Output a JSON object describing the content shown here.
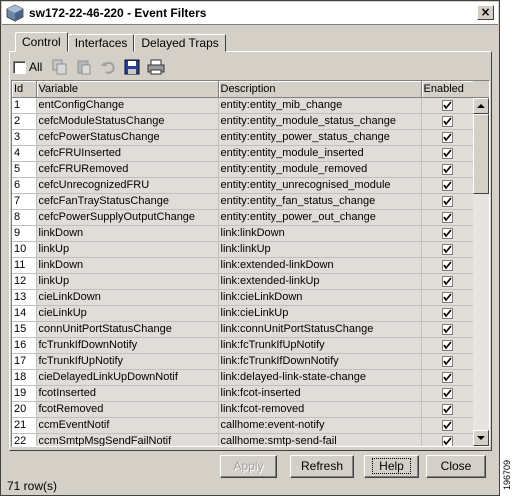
{
  "window": {
    "title": "sw172-22-46-220 - Event Filters",
    "close_label": "×"
  },
  "tabs": [
    {
      "label": "Control",
      "active": true
    },
    {
      "label": "Interfaces",
      "active": false
    },
    {
      "label": "Delayed Traps",
      "active": false
    }
  ],
  "toolbar": {
    "all_label": "All",
    "icons": [
      "copy-icon",
      "paste-icon",
      "undo-icon",
      "save-icon",
      "print-icon"
    ]
  },
  "table": {
    "columns": [
      "Id",
      "Variable",
      "Description",
      "Enabled"
    ],
    "rows": [
      {
        "id": "1",
        "variable": "entConfigChange",
        "description": "entity:entity_mib_change",
        "enabled": true
      },
      {
        "id": "2",
        "variable": "cefcModuleStatusChange",
        "description": "entity:entity_module_status_change",
        "enabled": true
      },
      {
        "id": "3",
        "variable": "cefcPowerStatusChange",
        "description": "entity:entity_power_status_change",
        "enabled": true
      },
      {
        "id": "4",
        "variable": "cefcFRUInserted",
        "description": "entity:entity_module_inserted",
        "enabled": true
      },
      {
        "id": "5",
        "variable": "cefcFRURemoved",
        "description": "entity:entity_module_removed",
        "enabled": true
      },
      {
        "id": "6",
        "variable": "cefcUnrecognizedFRU",
        "description": "entity:entity_unrecognised_module",
        "enabled": true
      },
      {
        "id": "7",
        "variable": "cefcFanTrayStatusChange",
        "description": "entity:entity_fan_status_change",
        "enabled": true
      },
      {
        "id": "8",
        "variable": "cefcPowerSupplyOutputChange",
        "description": "entity:entity_power_out_change",
        "enabled": true
      },
      {
        "id": "9",
        "variable": "linkDown",
        "description": "link:linkDown",
        "enabled": true
      },
      {
        "id": "10",
        "variable": "linkUp",
        "description": "link:linkUp",
        "enabled": true
      },
      {
        "id": "11",
        "variable": "linkDown",
        "description": "link:extended-linkDown",
        "enabled": true
      },
      {
        "id": "12",
        "variable": "linkUp",
        "description": "link:extended-linkUp",
        "enabled": true
      },
      {
        "id": "13",
        "variable": "cieLinkDown",
        "description": "link:cieLinkDown",
        "enabled": true
      },
      {
        "id": "14",
        "variable": "cieLinkUp",
        "description": "link:cieLinkUp",
        "enabled": true
      },
      {
        "id": "15",
        "variable": "connUnitPortStatusChange",
        "description": "link:connUnitPortStatusChange",
        "enabled": true
      },
      {
        "id": "16",
        "variable": "fcTrunkIfDownNotify",
        "description": "link:fcTrunkIfUpNotify",
        "enabled": true
      },
      {
        "id": "17",
        "variable": "fcTrunkIfUpNotify",
        "description": "link:fcTrunkIfDownNotify",
        "enabled": true
      },
      {
        "id": "18",
        "variable": "cieDelayedLinkUpDownNotif",
        "description": "link:delayed-link-state-change",
        "enabled": true
      },
      {
        "id": "19",
        "variable": "fcotInserted",
        "description": "link:fcot-inserted",
        "enabled": true
      },
      {
        "id": "20",
        "variable": "fcotRemoved",
        "description": "link:fcot-removed",
        "enabled": true
      },
      {
        "id": "21",
        "variable": "ccmEventNotif",
        "description": "callhome:event-notify",
        "enabled": true
      },
      {
        "id": "22",
        "variable": "ccmSmtpMsgSendFailNotif",
        "description": "callhome:smtp-send-fail",
        "enabled": true
      }
    ]
  },
  "buttons": {
    "apply": "Apply",
    "refresh": "Refresh",
    "help": "Help",
    "close": "Close"
  },
  "status": {
    "row_count": "71 row(s)"
  },
  "figure_id": "196709"
}
